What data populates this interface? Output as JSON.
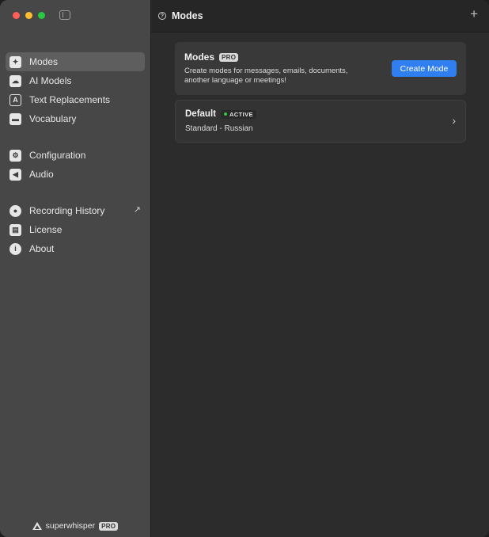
{
  "sidebar": {
    "items": [
      {
        "label": "Modes",
        "icon": "modes-icon",
        "active": true
      },
      {
        "label": "AI Models",
        "icon": "brain-icon"
      },
      {
        "label": "Text Replacements",
        "icon": "text-replace-icon"
      },
      {
        "label": "Vocabulary",
        "icon": "book-icon"
      },
      {
        "label": "Configuration",
        "icon": "gear-icon"
      },
      {
        "label": "Audio",
        "icon": "speaker-icon"
      },
      {
        "label": "Recording History",
        "icon": "history-icon",
        "external": true
      },
      {
        "label": "License",
        "icon": "license-icon"
      },
      {
        "label": "About",
        "icon": "info-icon"
      }
    ],
    "brand": {
      "name": "superwhisper",
      "badge": "PRO"
    }
  },
  "header": {
    "title": "Modes"
  },
  "modes_card": {
    "title": "Modes",
    "badge": "PRO",
    "description": "Create modes for messages, emails, documents, another language or meetings!",
    "button_label": "Create Mode"
  },
  "mode_list": [
    {
      "name": "Default",
      "status": "ACTIVE",
      "subtitle": "Standard - Russian"
    }
  ],
  "colors": {
    "accent": "#2f7ff0",
    "active_dot": "#2ecc40"
  }
}
